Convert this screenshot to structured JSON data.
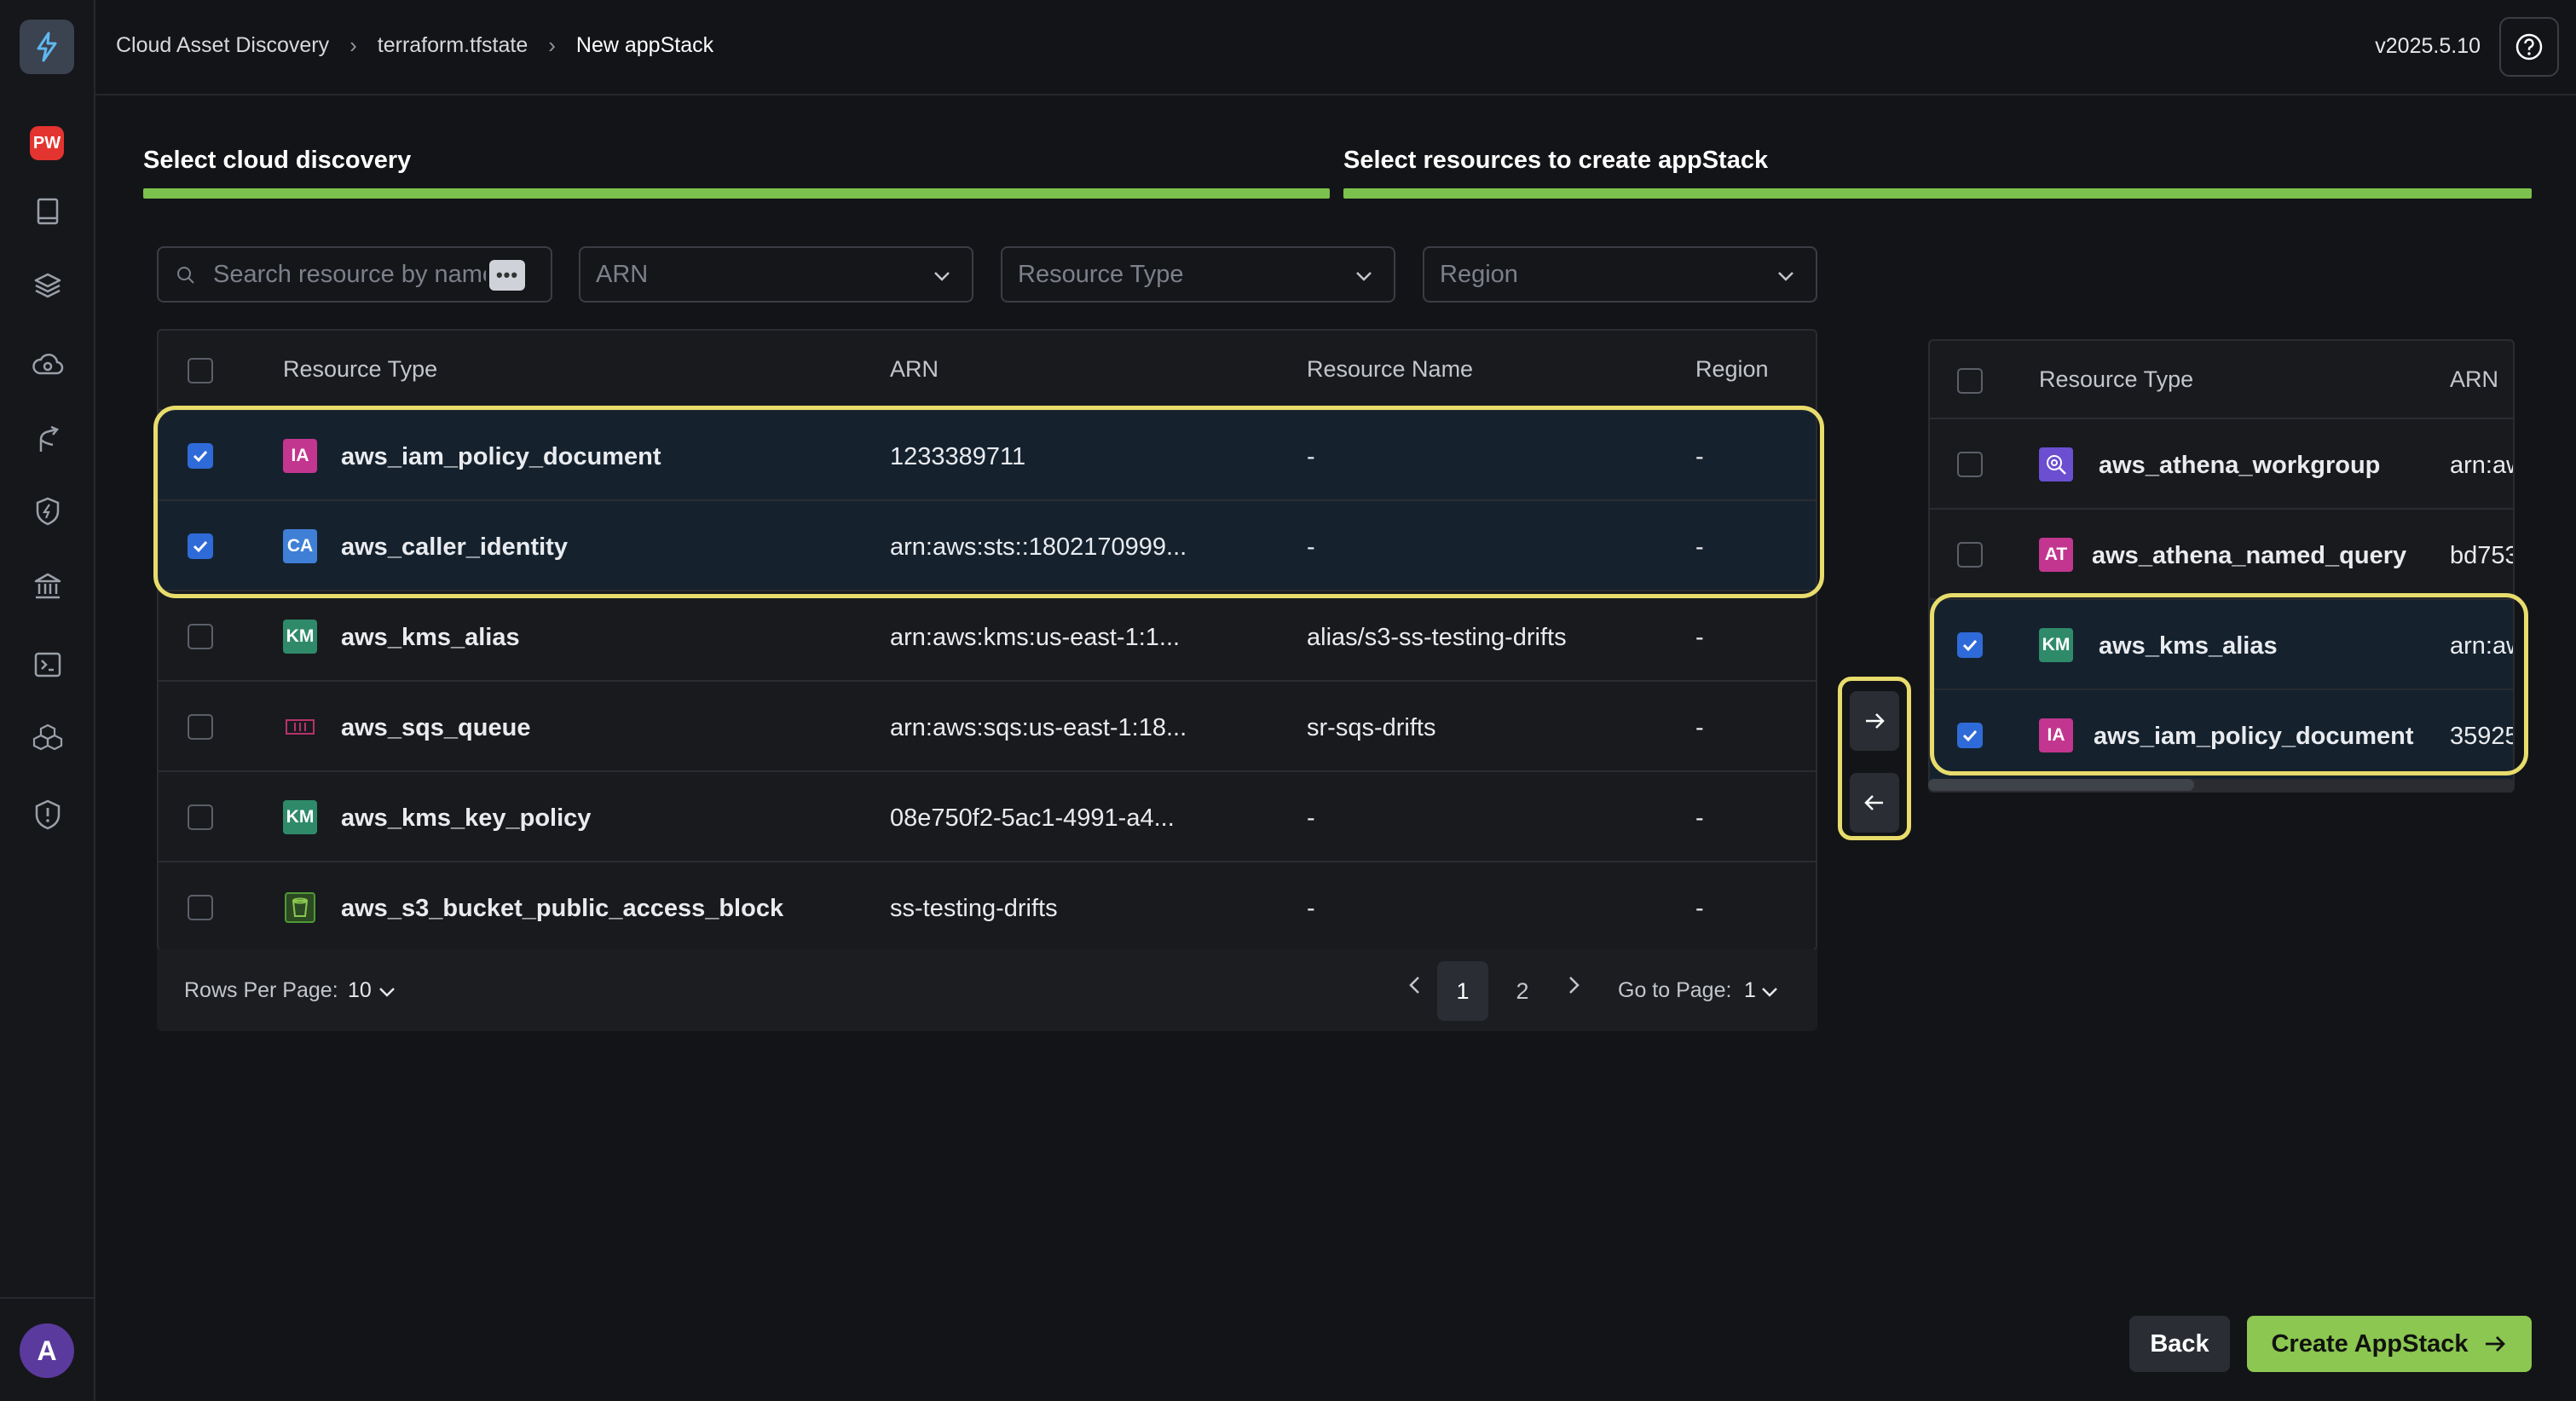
{
  "app": {
    "version": "v2025.5.10"
  },
  "sidebar": {
    "badge": "PW",
    "avatar": "A"
  },
  "breadcrumb": [
    "Cloud Asset Discovery",
    "terraform.tfstate",
    "New appStack"
  ],
  "steps": [
    "Select cloud discovery",
    "Select resources to create appStack"
  ],
  "filters": {
    "search_placeholder": "Search resource by name",
    "arn": "ARN",
    "resource_type": "Resource Type",
    "region": "Region"
  },
  "left_table": {
    "columns": [
      "Resource Type",
      "ARN",
      "Resource Name",
      "Region"
    ],
    "rows": [
      {
        "icon": "IA",
        "icon_color": "#c2368f",
        "type": "aws_iam_policy_document",
        "arn": "1233389711",
        "name": "-",
        "region": "-",
        "checked": true
      },
      {
        "icon": "CA",
        "icon_color": "#3f7fd6",
        "type": "aws_caller_identity",
        "arn": "arn:aws:sts::1802170999...",
        "name": "-",
        "region": "-",
        "checked": true
      },
      {
        "icon": "KM",
        "icon_color": "#2f8a6a",
        "type": "aws_kms_alias",
        "arn": "arn:aws:kms:us-east-1:1...",
        "name": "alias/s3-ss-testing-drifts",
        "region": "-",
        "checked": false
      },
      {
        "icon": "sqs-icon",
        "icon_color": "#b8326b",
        "type": "aws_sqs_queue",
        "arn": "arn:aws:sqs:us-east-1:18...",
        "name": "sr-sqs-drifts",
        "region": "-",
        "checked": false
      },
      {
        "icon": "KM",
        "icon_color": "#2f8a6a",
        "type": "aws_kms_key_policy",
        "arn": "08e750f2-5ac1-4991-a4...",
        "name": "-",
        "region": "-",
        "checked": false
      },
      {
        "icon": "s3-icon",
        "icon_color": "#4e9a35",
        "type": "aws_s3_bucket_public_access_block",
        "arn": "ss-testing-drifts",
        "name": "-",
        "region": "-",
        "checked": false
      }
    ]
  },
  "pagination": {
    "rows_per_page_label": "Rows Per Page:",
    "rows_per_page": "10",
    "pages": [
      "1",
      "2"
    ],
    "current_page": "1",
    "go_to_label": "Go to Page:",
    "go_to_value": "1"
  },
  "right_table": {
    "columns": [
      "Resource Type",
      "ARN"
    ],
    "rows": [
      {
        "icon": "athena-icon",
        "icon_color": "#6b4fd0",
        "type": "aws_athena_workgroup",
        "arn": "arn:aw",
        "checked": false
      },
      {
        "icon": "AT",
        "icon_color": "#c2368f",
        "type": "aws_athena_named_query",
        "arn": "bd753",
        "checked": false
      },
      {
        "icon": "KM",
        "icon_color": "#2f8a6a",
        "type": "aws_kms_alias",
        "arn": "arn:aw",
        "checked": true
      },
      {
        "icon": "IA",
        "icon_color": "#c2368f",
        "type": "aws_iam_policy_document",
        "arn": "35925",
        "checked": true
      }
    ]
  },
  "buttons": {
    "back": "Back",
    "create": "Create AppStack"
  }
}
